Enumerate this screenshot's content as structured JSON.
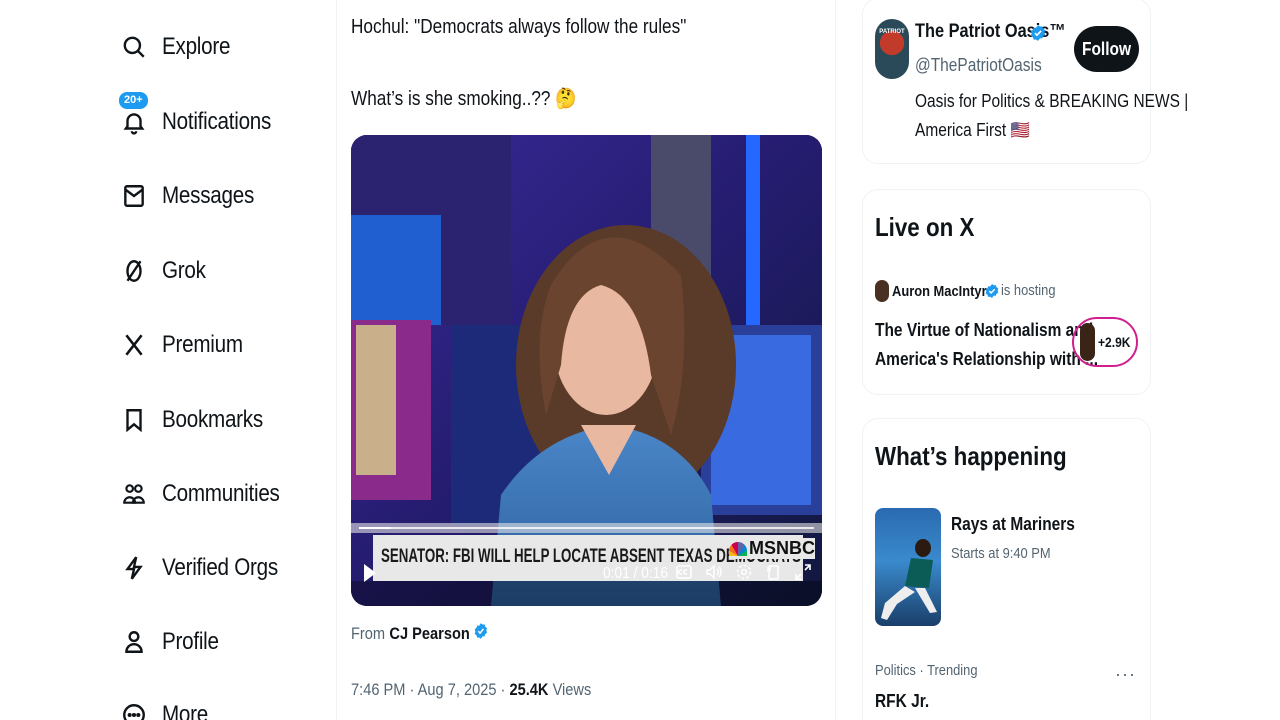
{
  "sidebar": {
    "items": [
      {
        "label": "Explore",
        "icon": "search-icon"
      },
      {
        "label": "Notifications",
        "icon": "bell-icon",
        "badge": "20+"
      },
      {
        "label": "Messages",
        "icon": "envelope-icon"
      },
      {
        "label": "Grok",
        "icon": "grok-icon"
      },
      {
        "label": "Premium",
        "icon": "x-logo-icon"
      },
      {
        "label": "Bookmarks",
        "icon": "bookmark-icon"
      },
      {
        "label": "Communities",
        "icon": "communities-icon"
      },
      {
        "label": "Verified Orgs",
        "icon": "lightning-icon"
      },
      {
        "label": "Profile",
        "icon": "person-icon"
      },
      {
        "label": "More",
        "icon": "more-circle-icon"
      }
    ]
  },
  "tweet": {
    "line1": "Hochul: \"Democrats always follow the rules\"",
    "line2": "What’s is she smoking..??",
    "line2_emoji": "🤔",
    "video": {
      "chyron": "SENATOR: FBI WILL HELP LOCATE ABSENT TEXAS DEMOCRATS",
      "network": "MSNBC",
      "time": "0:01 / 0:16",
      "progress": 0.07
    },
    "from_prefix": "From",
    "from_name": "CJ Pearson",
    "time": "7:46 PM · Aug 7, 2025 · ",
    "views_count": "25.4K",
    "views_label": " Views"
  },
  "profile_card": {
    "name": "The Patriot Oasis™",
    "handle": "@ThePatriotOasis",
    "bio_line1": "Oasis for Politics & BREAKING NEWS |",
    "bio_line2": "America First 🇺🇸",
    "follow_label": "Follow",
    "avatar_text": "PATRIOT"
  },
  "live": {
    "title": "Live on X",
    "host_name": "Auron MacIntyre",
    "host_status": "is hosting",
    "space_line1": "The Virtue of Nationalism and",
    "space_line2": "America's Relationship with ...",
    "listeners": "+2.9K"
  },
  "happening": {
    "title": "What’s happening",
    "event_title": "Rays at Mariners",
    "event_time": "Starts at 9:40 PM",
    "trend_context": "Politics · Trending",
    "trend_name": "RFK Jr.",
    "trend_menu": "···"
  },
  "colors": {
    "accent": "#1d9bf0",
    "text": "#0f1419",
    "muted": "#536471",
    "live_ring": "#d21f8f"
  }
}
